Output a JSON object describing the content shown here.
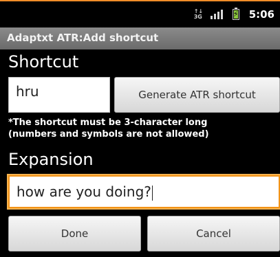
{
  "status_bar": {
    "network_type": "3G",
    "time": "5:06",
    "icons": [
      "3g-icon",
      "signal-icon",
      "battery-charging-icon"
    ]
  },
  "app": {
    "title": "Adaptxt ATR:Add shortcut"
  },
  "shortcut": {
    "label": "Shortcut",
    "value": "hru",
    "generate_label": "Generate ATR shortcut",
    "note_line1": "*The shortcut must be 3-character long",
    "note_line2": "(numbers and symbols are not allowed)"
  },
  "expansion": {
    "label": "Expansion",
    "value": "how are you doing?"
  },
  "actions": {
    "done_label": "Done",
    "cancel_label": "Cancel"
  },
  "colors": {
    "accent": "#f08c28",
    "focus": "#f29318",
    "title_bar": "#7a7a7a"
  }
}
